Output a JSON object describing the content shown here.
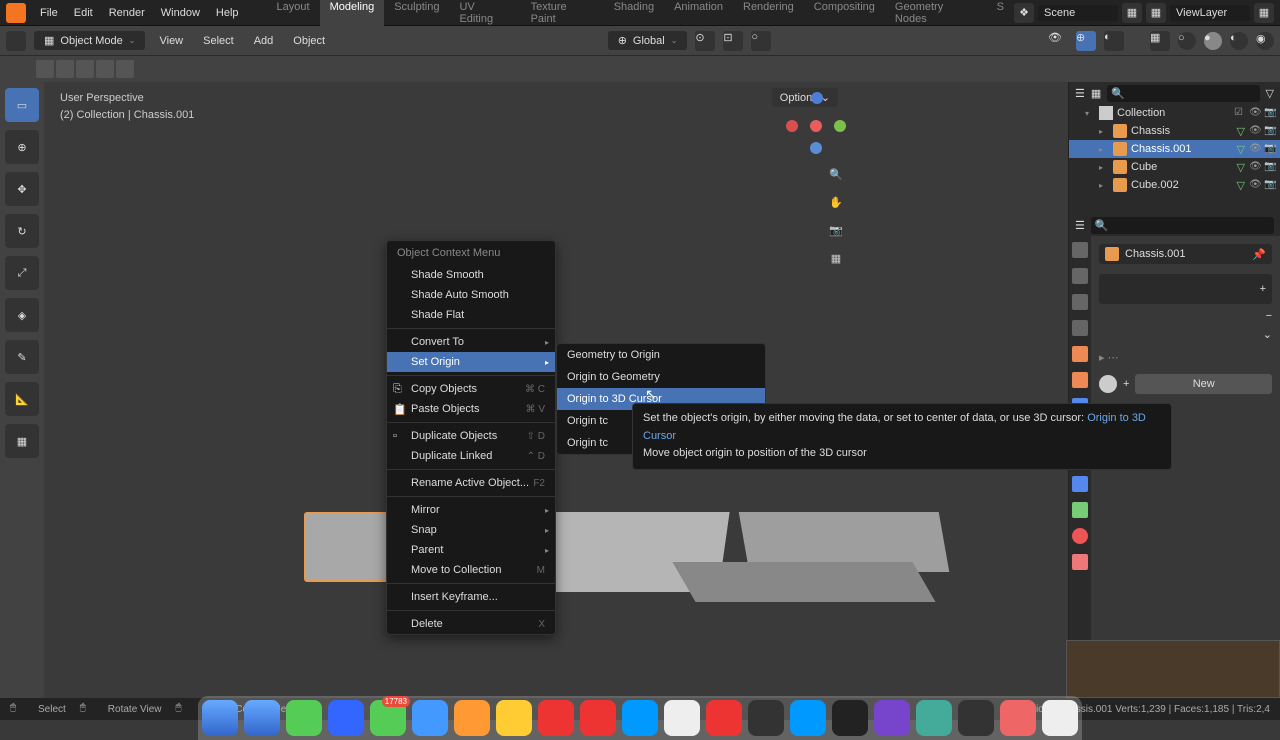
{
  "topmenu": {
    "file": "File",
    "edit": "Edit",
    "render": "Render",
    "window": "Window",
    "help": "Help"
  },
  "tabs": [
    "Layout",
    "Modeling",
    "Sculpting",
    "UV Editing",
    "Texture Paint",
    "Shading",
    "Animation",
    "Rendering",
    "Compositing",
    "Geometry Nodes",
    "S"
  ],
  "active_tab": 1,
  "scene_field": "Scene",
  "viewlayer_field": "ViewLayer",
  "header2": {
    "mode": "Object Mode",
    "view": "View",
    "select": "Select",
    "add": "Add",
    "object": "Object",
    "orientation": "Global",
    "options": "Options"
  },
  "perspective": {
    "line1": "User Perspective",
    "line2": "(2) Collection | Chassis.001"
  },
  "ctx": {
    "title": "Object Context Menu",
    "shade_smooth": "Shade Smooth",
    "shade_auto": "Shade Auto Smooth",
    "shade_flat": "Shade Flat",
    "convert": "Convert To",
    "set_origin": "Set Origin",
    "copy": "Copy Objects",
    "copy_sc": "⌘ C",
    "paste": "Paste Objects",
    "paste_sc": "⌘ V",
    "dup": "Duplicate Objects",
    "dup_sc": "⇧ D",
    "dup_linked": "Duplicate Linked",
    "dup_linked_sc": "⌃ D",
    "rename": "Rename Active Object...",
    "rename_sc": "F2",
    "mirror": "Mirror",
    "snap": "Snap",
    "parent": "Parent",
    "move_coll": "Move to Collection",
    "move_coll_sc": "M",
    "insert_kf": "Insert Keyframe...",
    "delete": "Delete",
    "delete_sc": "X"
  },
  "submenu": {
    "geom_origin": "Geometry to Origin",
    "origin_geom": "Origin to Geometry",
    "origin_cursor": "Origin to 3D Cursor",
    "origin_tc1": "Origin tc",
    "origin_tc2": "Origin tc"
  },
  "tooltip": {
    "line1a": "Set the object's origin, by either moving the data, or set to center of data, or use 3D cursor:",
    "line1b": "Origin to 3D Cursor",
    "line2": "Move object origin to position of the 3D cursor"
  },
  "outliner": {
    "collection": "Collection",
    "chassis": "Chassis",
    "chassis001": "Chassis.001",
    "cube": "Cube",
    "cube002": "Cube.002"
  },
  "props": {
    "obj_name": "Chassis.001",
    "new": "New"
  },
  "status": {
    "select": "Select",
    "rotate": "Rotate View",
    "ctx": "Object Context Menu",
    "stats": "Collection | Chassis.001   Verts:1,239  |  Faces:1,185  |  Tris:2,4"
  },
  "dock_badge": "17783"
}
